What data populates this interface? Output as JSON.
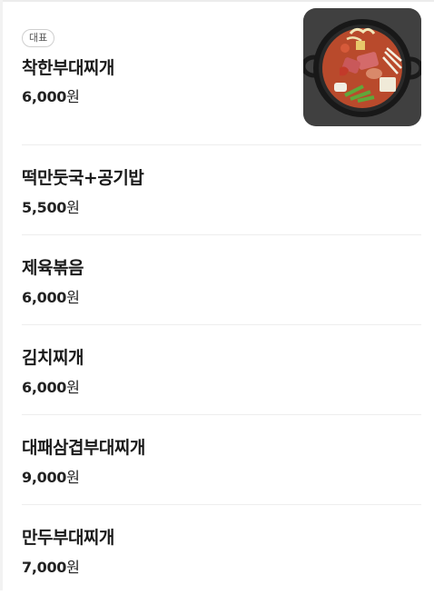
{
  "menu": {
    "items": [
      {
        "badge": "대표",
        "name": "착한부대찌개",
        "price_num": "6,000",
        "currency": "원",
        "has_image": true,
        "image": "budae-jjigae-photo"
      },
      {
        "name": "떡만둣국+공기밥",
        "price_num": "5,500",
        "currency": "원"
      },
      {
        "name": "제육볶음",
        "price_num": "6,000",
        "currency": "원"
      },
      {
        "name": "김치찌개",
        "price_num": "6,000",
        "currency": "원"
      },
      {
        "name": "대패삼겹부대찌개",
        "price_num": "9,000",
        "currency": "원"
      },
      {
        "name": "만두부대찌개",
        "price_num": "7,000",
        "currency": "원"
      }
    ]
  }
}
